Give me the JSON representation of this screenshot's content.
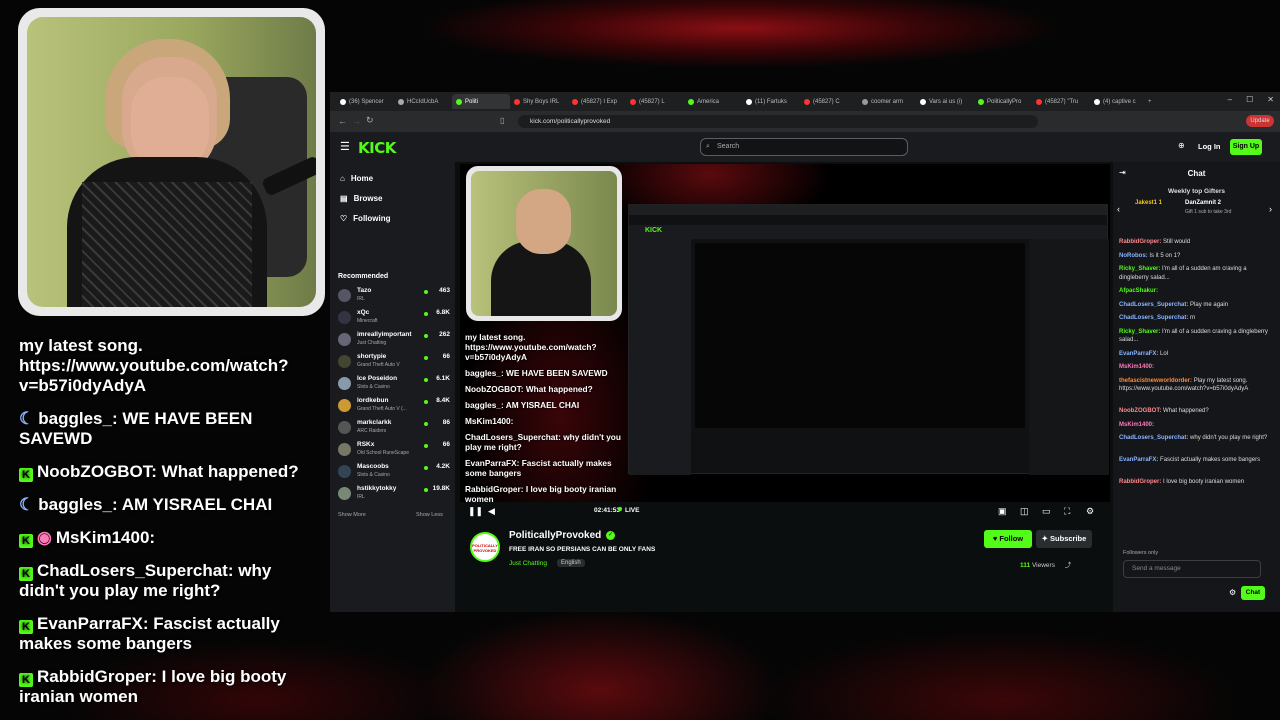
{
  "overlay": {
    "chat": [
      {
        "badge": "none",
        "text": "my latest song. https://www.youtube.com/watch?v=b57i0dyAdyA"
      },
      {
        "badge": "moon",
        "user": "baggles_",
        "text": "WE HAVE BEEN SAVEWD"
      },
      {
        "badge": "kick",
        "user": "NoobZOGBOT",
        "text": "What happened?"
      },
      {
        "badge": "moon",
        "user": "baggles_",
        "text": "AM YISRAEL CHAI"
      },
      {
        "badge": "kick-pink",
        "user": "MsKim1400",
        "text": ""
      },
      {
        "badge": "kick",
        "user": "ChadLosers_Superchat",
        "text": "why didn't you play me right?"
      },
      {
        "badge": "kick",
        "user": "EvanParraFX",
        "text": "Fascist actually makes some bangers"
      },
      {
        "badge": "kick",
        "user": "RabbidGroper",
        "text": "I love big booty iranian women"
      }
    ]
  },
  "browser": {
    "tabs": [
      {
        "label": "(36) Spencer",
        "color": "#fff",
        "active": false
      },
      {
        "label": "HCcIdUcbA",
        "color": "#aaa",
        "active": false
      },
      {
        "label": "Politi",
        "color": "#53fc18",
        "active": true
      },
      {
        "label": "Shy Boys IRL",
        "color": "#f33",
        "active": false
      },
      {
        "label": "(45827) I Exp",
        "color": "#f33",
        "active": false
      },
      {
        "label": "(45827) L",
        "color": "#f33",
        "active": false
      },
      {
        "label": "America",
        "color": "#53fc18",
        "active": false
      },
      {
        "label": "(11) Fartuks",
        "color": "#fff",
        "active": false
      },
      {
        "label": "(45827) C",
        "color": "#f33",
        "active": false
      },
      {
        "label": "coomer arm",
        "color": "#999",
        "active": false
      },
      {
        "label": "Vars ai us (i)",
        "color": "#fff",
        "active": false
      },
      {
        "label": "PoliticallyPro",
        "color": "#53fc18",
        "active": false
      },
      {
        "label": "(45827) \"Tru",
        "color": "#f33",
        "active": false
      },
      {
        "label": "(4) captive c",
        "color": "#fff",
        "active": false
      }
    ],
    "url": "kick.com/politicallyprovoked",
    "update_label": "Update"
  },
  "kick": {
    "logo": "KICK",
    "search_placeholder": "Search",
    "login": "Log In",
    "signup": "Sign Up",
    "nav": {
      "home": "Home",
      "browse": "Browse",
      "following": "Following"
    },
    "recommended_title": "Recommended",
    "recommended": [
      {
        "name": "Tazo",
        "category": "IRL",
        "viewers": "463",
        "color": "#556"
      },
      {
        "name": "xQc",
        "category": "Minecraft",
        "viewers": "6.8K",
        "color": "#334"
      },
      {
        "name": "imreallyimportant",
        "category": "Just Chatting",
        "viewers": "262",
        "color": "#667"
      },
      {
        "name": "shortypie",
        "category": "Grand Theft Auto V",
        "viewers": "66",
        "color": "#443"
      },
      {
        "name": "Ice Poseidon",
        "category": "Slots & Casino",
        "viewers": "6.1K",
        "color": "#89a"
      },
      {
        "name": "lordkebun",
        "category": "Grand Theft Auto V (...",
        "viewers": "8.4K",
        "color": "#c93"
      },
      {
        "name": "markclarkk",
        "category": "ARC Raiders",
        "viewers": "86",
        "color": "#555"
      },
      {
        "name": "RSKx",
        "category": "Old School RuneScape",
        "viewers": "66",
        "color": "#776"
      },
      {
        "name": "Mascoobs",
        "category": "Slots & Casino",
        "viewers": "4.2K",
        "color": "#345"
      },
      {
        "name": "hstikkytokky",
        "category": "IRL",
        "viewers": "19.8K",
        "color": "#787"
      }
    ],
    "show_more": "Show More",
    "show_less": "Show Less",
    "player": {
      "chat": [
        {
          "text": "my latest song. https://www.youtube.com/watch?v=b57i0dyAdyA"
        },
        {
          "text": "baggles_: WE HAVE BEEN SAVEWD"
        },
        {
          "text": "NoobZOGBOT: What happened?"
        },
        {
          "text": "baggles_: AM YISRAEL CHAI"
        },
        {
          "text": "MsKim1400:"
        },
        {
          "text": "ChadLosers_Superchat: why didn't you play me right?"
        },
        {
          "text": "EvanParraFX: Fascist actually makes some bangers"
        },
        {
          "text": "RabbidGroper: I love big booty iranian women"
        }
      ],
      "time": "02:41:53",
      "live": "LIVE",
      "progress": 1.0
    },
    "stream": {
      "channel": "PoliticallyProvoked",
      "avatar_text": "POLITICALLY PROVOKED",
      "title": "FREE IRAN SO PERSIANS CAN BE ONLY FANS",
      "category": "Just Chatting",
      "language": "English",
      "follow": "Follow",
      "subscribe": "Subscribe",
      "viewers_count": "111",
      "viewers_label": "Viewers"
    },
    "chat": {
      "title": "Chat",
      "gifters_title": "Weekly top Gifters",
      "gifters": [
        {
          "name": "Jakest1",
          "count": "1"
        },
        {
          "name": "DanZamnit",
          "count": "2"
        }
      ],
      "gift_note": "Gift 1 sub to take 3rd",
      "messages": [
        {
          "user": "RabbidGroper",
          "color": "#ff8a8a",
          "text": "Still would"
        },
        {
          "user": "NoRobos",
          "color": "#8ab4ff",
          "text": "Is it 5 on 1?"
        },
        {
          "user": "Ricky_Shaver",
          "color": "#53fc18",
          "text": "I'm all of a sudden am craving a dingleberry salad..."
        },
        {
          "user": "AfpacShakur",
          "color": "#53fc18",
          "text": ""
        },
        {
          "user": "ChadLosers_Superchat",
          "color": "#8ab4ff",
          "text": "Play me again"
        },
        {
          "user": "ChadLosers_Superchat",
          "color": "#8ab4ff",
          "text": "rn"
        },
        {
          "user": "Ricky_Shaver",
          "color": "#53fc18",
          "text": "I'm all of a sudden craving a dingleberry salad..."
        },
        {
          "user": "EvanParraFX",
          "color": "#8ab4ff",
          "text": "Lol"
        },
        {
          "user": "MsKim1400",
          "color": "#ff7ab6",
          "text": ""
        },
        {
          "user": "thefascistnewworldorder",
          "color": "#ff8a3d",
          "text": "Play my latest song. https://www.youtube.com/watch?v=b57i0dyAdyA"
        },
        {
          "user": "NoobZOGBOT",
          "color": "#ff8a8a",
          "text": "What happened?"
        },
        {
          "user": "MsKim1400",
          "color": "#ff7ab6",
          "text": ""
        },
        {
          "user": "ChadLosers_Superchat",
          "color": "#8ab4ff",
          "text": "why didn't you play me right?"
        },
        {
          "user": "EvanParraFX",
          "color": "#8ab4ff",
          "text": "Fascist actually makes some bangers"
        },
        {
          "user": "RabbidGroper",
          "color": "#ff8a8a",
          "text": "I love big booty iranian women"
        }
      ],
      "followers_only": "Followers only",
      "send_placeholder": "Send a message",
      "send_button": "Chat"
    }
  }
}
